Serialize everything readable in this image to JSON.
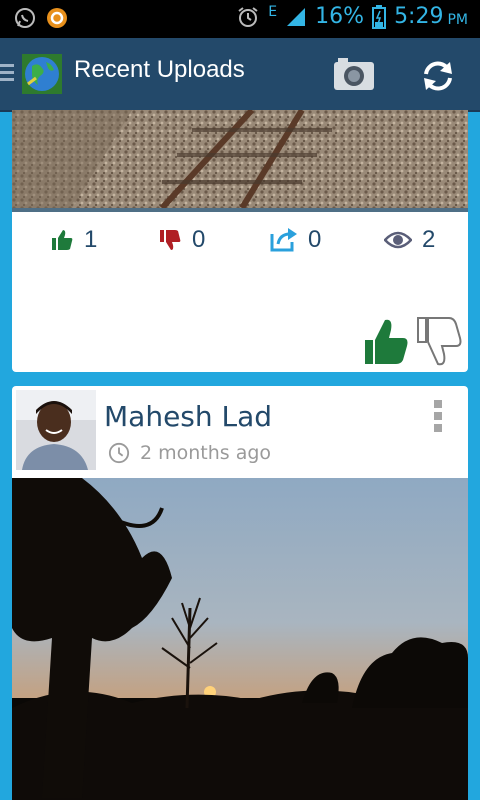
{
  "status_bar": {
    "battery_percent": "16%",
    "time": "5:29",
    "ampm": "PM",
    "network": "E",
    "icons": [
      "whatsapp-icon",
      "notification-app-icon",
      "alarm-icon",
      "signal-icon",
      "battery-icon"
    ]
  },
  "action_bar": {
    "title": "Recent Uploads",
    "icons": [
      "menu-icon",
      "globe-logo-icon",
      "camera-icon",
      "refresh-icon"
    ]
  },
  "post1": {
    "likes": "1",
    "dislikes": "0",
    "shares": "0",
    "views": "2",
    "colors": {
      "like": "#1e7a3b",
      "dislike": "#b01f24",
      "share": "#2aa0dc",
      "views": "#5a5e78"
    }
  },
  "post2": {
    "user_name": "Mahesh Lad",
    "time_ago": "2 months ago"
  },
  "colors": {
    "background": "#22a7de",
    "action_bar": "#23496a",
    "text_primary": "#23496a"
  }
}
